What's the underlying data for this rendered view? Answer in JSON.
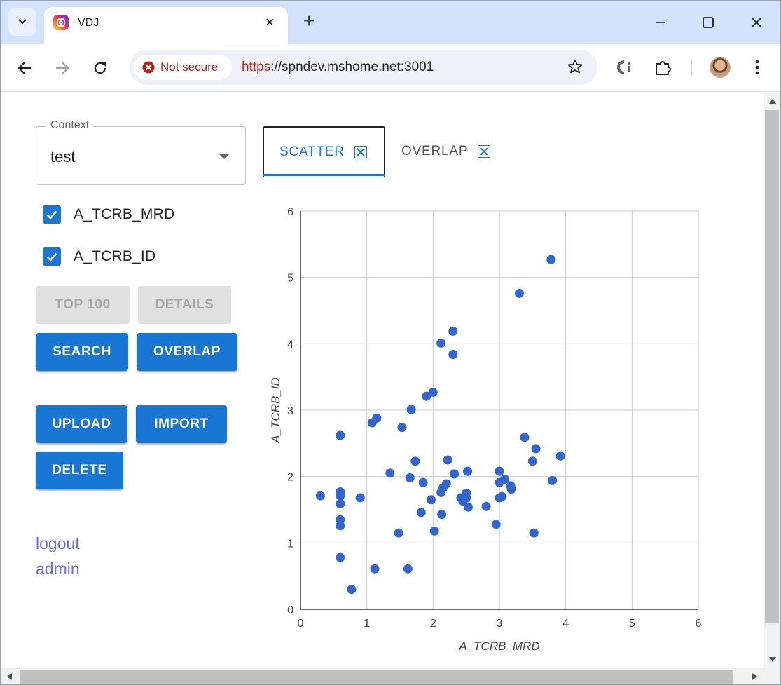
{
  "browser": {
    "tab_title": "VDJ",
    "tab_close": "×",
    "new_tab": "+",
    "security_label": "Not secure",
    "url_scheme": "https",
    "url_rest": "://spndev.mshome.net:3001",
    "icons": [
      "tab-list-icon",
      "instagram-favicon-icon",
      "close-icon",
      "plus-icon",
      "minimize-icon",
      "maximize-icon",
      "window-close-icon",
      "back-icon",
      "forward-icon",
      "reload-icon",
      "not-secure-icon",
      "star-icon",
      "extension-c-icon",
      "puzzle-icon",
      "profile-avatar",
      "more-vert-icon"
    ]
  },
  "sidebar": {
    "context_label": "Context",
    "context_value": "test",
    "checkboxes": [
      {
        "label": "A_TCRB_MRD",
        "checked": true
      },
      {
        "label": "A_TCRB_ID",
        "checked": true
      }
    ],
    "buttons": {
      "top100": "TOP 100",
      "details": "DETAILS",
      "search": "SEARCH",
      "overlap": "OVERLAP",
      "upload": "UPLOAD",
      "import": "IMPORT",
      "delete": "DELETE"
    },
    "links": {
      "logout": "logout",
      "admin": "admin"
    }
  },
  "view_tabs": [
    {
      "label": "SCATTER",
      "active": true
    },
    {
      "label": "OVERLAP",
      "active": false
    }
  ],
  "colors": {
    "accent": "#1976d2",
    "point": "#3366cc",
    "link": "#6a6ef0",
    "danger": "#b3261e"
  },
  "chart_data": {
    "type": "scatter",
    "xlabel": "A_TCRB_MRD",
    "ylabel": "A_TCRB_ID",
    "xlim": [
      0,
      6
    ],
    "ylim": [
      0,
      6
    ],
    "xticks": [
      "0",
      "1",
      "2",
      "3",
      "4",
      "5",
      "6"
    ],
    "yticks": [
      "0",
      "1",
      "2",
      "3",
      "4",
      "5",
      "6"
    ],
    "grid": true,
    "points": [
      [
        3.78,
        5.27
      ],
      [
        3.3,
        4.76
      ],
      [
        2.3,
        4.19
      ],
      [
        2.12,
        4.01
      ],
      [
        2.3,
        3.84
      ],
      [
        2.0,
        3.27
      ],
      [
        1.9,
        3.21
      ],
      [
        1.67,
        3.01
      ],
      [
        1.15,
        2.88
      ],
      [
        1.08,
        2.81
      ],
      [
        1.53,
        2.74
      ],
      [
        0.6,
        2.62
      ],
      [
        3.38,
        2.59
      ],
      [
        3.55,
        2.42
      ],
      [
        3.92,
        2.31
      ],
      [
        2.22,
        2.25
      ],
      [
        1.73,
        2.23
      ],
      [
        3.5,
        2.23
      ],
      [
        3.0,
        2.08
      ],
      [
        2.52,
        2.08
      ],
      [
        1.35,
        2.05
      ],
      [
        2.32,
        2.04
      ],
      [
        1.65,
        1.98
      ],
      [
        3.08,
        1.96
      ],
      [
        3.8,
        1.94
      ],
      [
        1.85,
        1.91
      ],
      [
        3.0,
        1.91
      ],
      [
        2.2,
        1.89
      ],
      [
        3.17,
        1.86
      ],
      [
        2.15,
        1.83
      ],
      [
        3.18,
        1.81
      ],
      [
        2.12,
        1.76
      ],
      [
        2.5,
        1.75
      ],
      [
        0.6,
        1.77
      ],
      [
        0.6,
        1.71
      ],
      [
        0.3,
        1.71
      ],
      [
        2.42,
        1.68
      ],
      [
        2.5,
        1.68
      ],
      [
        0.9,
        1.68
      ],
      [
        3.04,
        1.7
      ],
      [
        3.0,
        1.68
      ],
      [
        1.97,
        1.65
      ],
      [
        2.45,
        1.63
      ],
      [
        0.6,
        1.59
      ],
      [
        2.53,
        1.54
      ],
      [
        2.8,
        1.55
      ],
      [
        1.82,
        1.46
      ],
      [
        2.13,
        1.43
      ],
      [
        0.6,
        1.35
      ],
      [
        0.6,
        1.26
      ],
      [
        2.95,
        1.28
      ],
      [
        2.02,
        1.18
      ],
      [
        1.48,
        1.15
      ],
      [
        3.52,
        1.15
      ],
      [
        0.6,
        0.78
      ],
      [
        1.12,
        0.61
      ],
      [
        1.62,
        0.61
      ],
      [
        0.77,
        0.3
      ]
    ]
  }
}
